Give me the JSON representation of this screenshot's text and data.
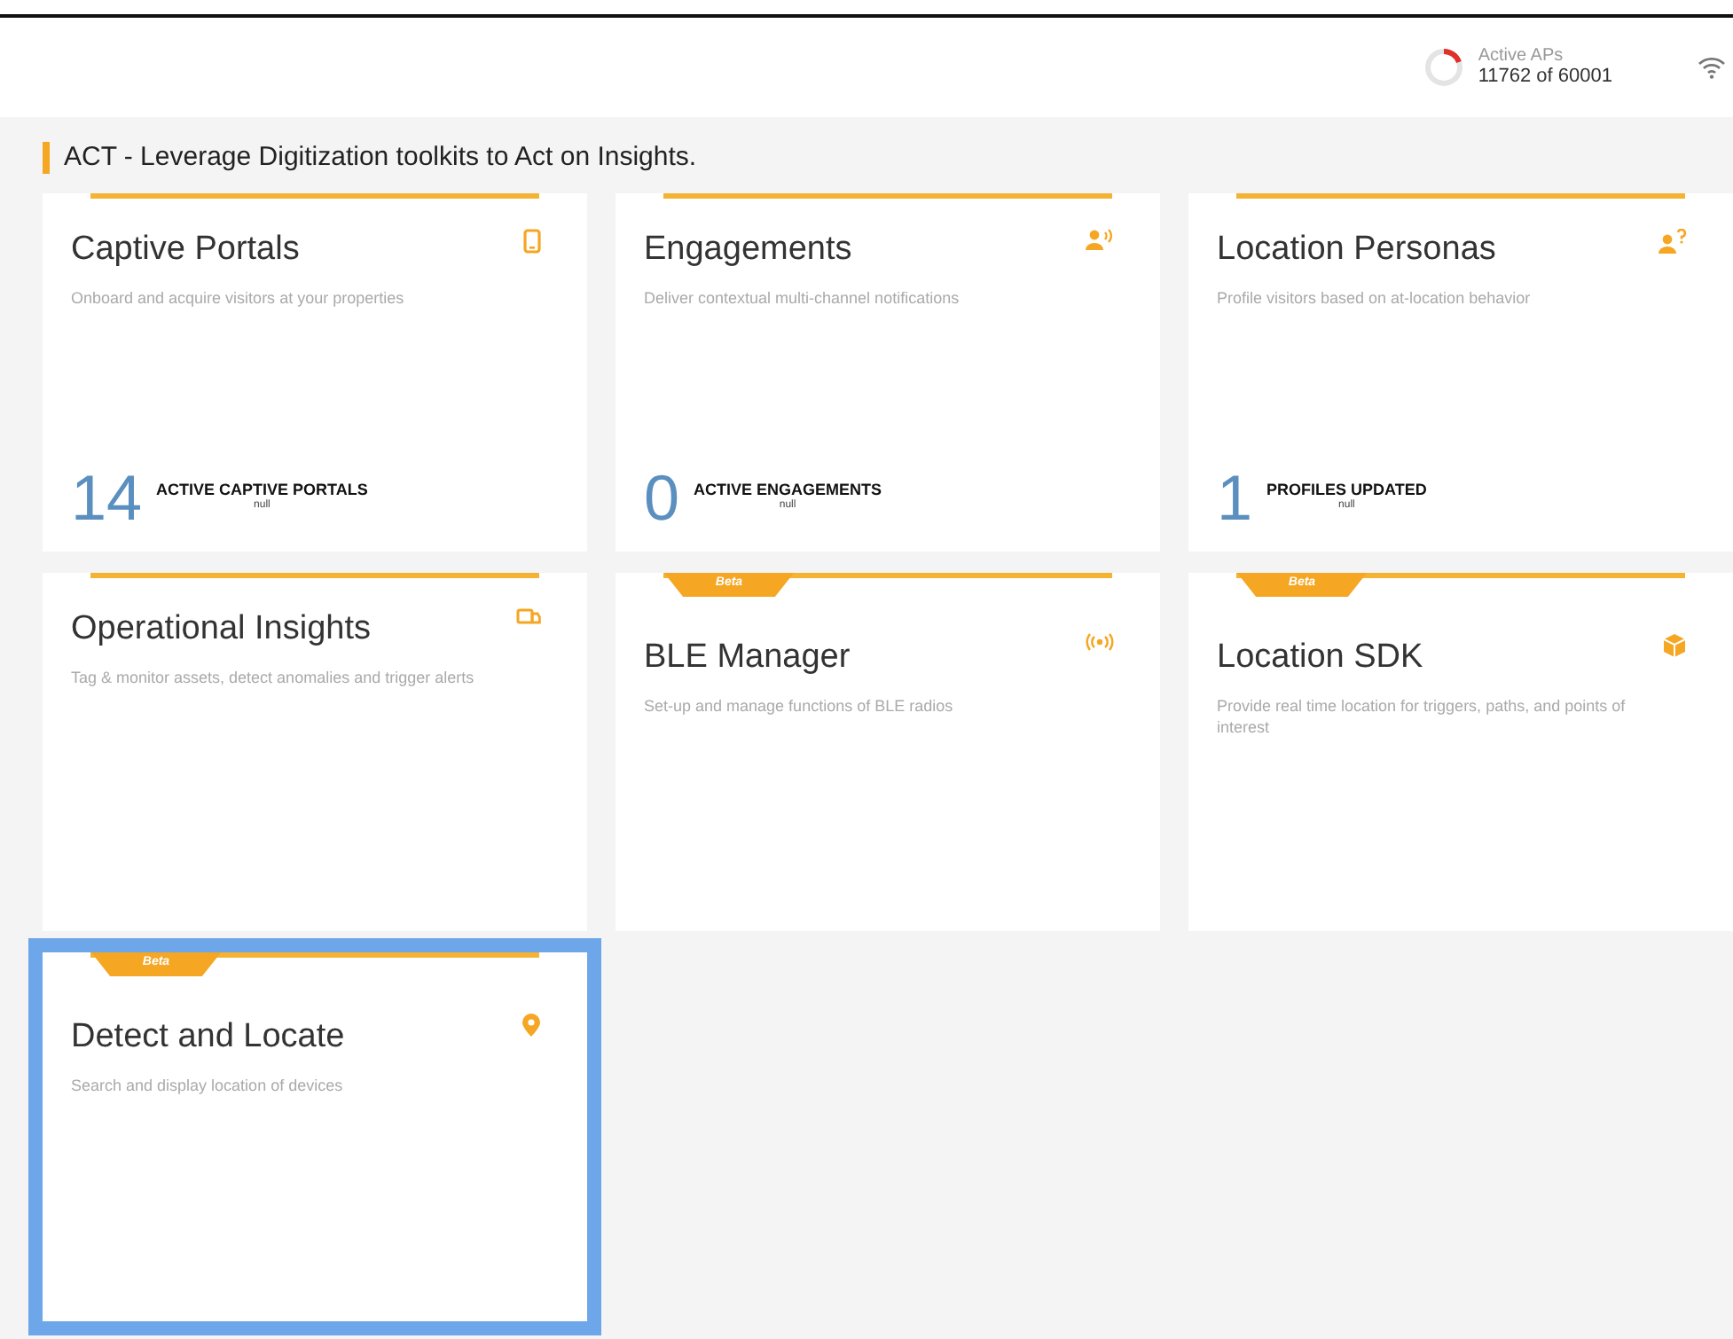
{
  "header": {
    "active_aps": {
      "label": "Active APs",
      "reading": "11762 of 60001"
    }
  },
  "section": {
    "title": "ACT - Leverage Digitization toolkits to Act on Insights."
  },
  "cards": [
    {
      "title": "Captive Portals",
      "description": "Onboard and acquire visitors at your properties",
      "beta": false,
      "selected": false,
      "stat": {
        "value": "14",
        "label": "ACTIVE CAPTIVE PORTALS",
        "sub": "null"
      }
    },
    {
      "title": "Engagements",
      "description": "Deliver contextual multi-channel notifications",
      "beta": false,
      "selected": false,
      "stat": {
        "value": "0",
        "label": "ACTIVE ENGAGEMENTS",
        "sub": "null"
      }
    },
    {
      "title": "Location Personas",
      "description": "Profile visitors based on at-location behavior",
      "beta": false,
      "selected": false,
      "stat": {
        "value": "1",
        "label": "PROFILES UPDATED",
        "sub": "null"
      }
    },
    {
      "title": "Operational Insights",
      "description": "Tag & monitor assets, detect anomalies and trigger alerts",
      "beta": false,
      "selected": false
    },
    {
      "title": "BLE Manager",
      "description": "Set-up and manage functions of BLE radios",
      "beta": true,
      "badge": "Beta",
      "selected": false
    },
    {
      "title": "Location SDK",
      "description": "Provide real time location for triggers, paths, and points of interest",
      "beta": true,
      "badge": "Beta",
      "selected": false
    },
    {
      "title": "Detect and Locate",
      "description": "Search and display location of devices",
      "beta": true,
      "badge": "Beta",
      "selected": true
    }
  ]
}
